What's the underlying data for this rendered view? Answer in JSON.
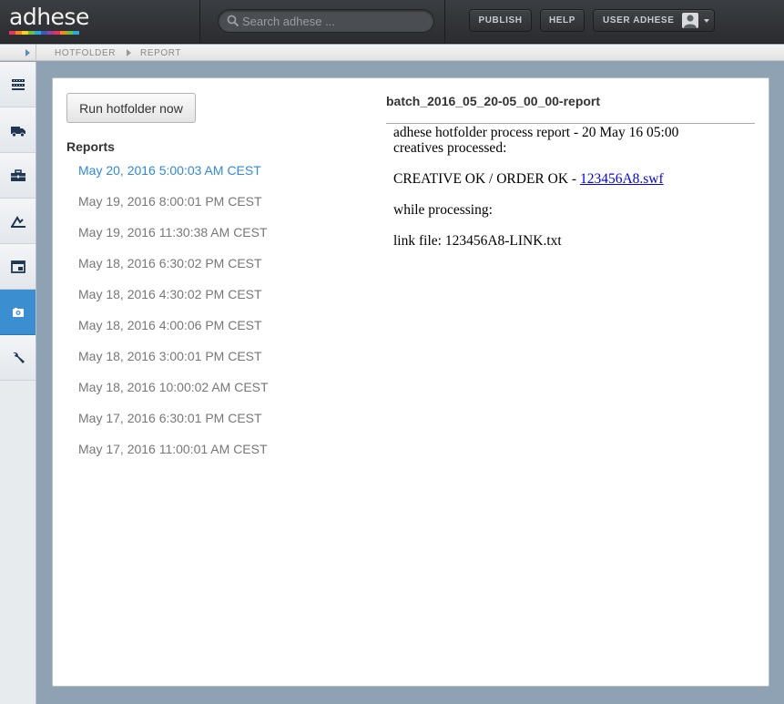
{
  "app": {
    "logo_text": "adhese",
    "logo_colors": [
      "#e5365a",
      "#f08a24",
      "#f6d21e",
      "#6cbe45",
      "#2aa7df",
      "#3b5bb5",
      "#9b3fa0",
      "#e5365a",
      "#f08a24",
      "#6cbe45",
      "#2aa7df"
    ]
  },
  "header": {
    "search": {
      "placeholder": "Search adhese ..."
    },
    "publish_label": "PUBLISH",
    "help_label": "HELP",
    "user_label": "USER ADHESE"
  },
  "breadcrumb": [
    "HOTFOLDER",
    "REPORT"
  ],
  "sidebar": {
    "items": [
      {
        "icon": "inventory-icon",
        "active": false
      },
      {
        "icon": "truck-icon",
        "active": false
      },
      {
        "icon": "briefcase-icon",
        "active": false
      },
      {
        "icon": "chart-tools-icon",
        "active": false
      },
      {
        "icon": "window-icon",
        "active": false
      },
      {
        "icon": "hotfolder-icon",
        "active": true
      },
      {
        "icon": "wrench-icon",
        "active": false
      }
    ],
    "active_color": "#3b8fd0"
  },
  "main": {
    "run_button_label": "Run hotfolder now",
    "reports_heading": "Reports",
    "reports": [
      "May 20, 2016 5:00:03 AM CEST",
      "May 19, 2016 8:00:01 PM CEST",
      "May 19, 2016 11:30:38 AM CEST",
      "May 18, 2016 6:30:02 PM CEST",
      "May 18, 2016 4:30:02 PM CEST",
      "May 18, 2016 4:00:06 PM CEST",
      "May 18, 2016 3:00:01 PM CEST",
      "May 18, 2016 10:00:02 AM CEST",
      "May 17, 2016 6:30:01 PM CEST",
      "May 17, 2016 11:00:01 AM CEST"
    ],
    "selected_report_index": 0,
    "report": {
      "title": "batch_2016_05_20-05_00_00-report",
      "line1": "adhese hotfolder process report - 20 May 16 05:00",
      "line2": "creatives processed:",
      "creative_prefix": "CREATIVE OK / ORDER OK - ",
      "creative_link": "123456A8.swf",
      "while_processing": "while processing:",
      "link_file": "link file: 123456A8-LINK.txt"
    }
  }
}
